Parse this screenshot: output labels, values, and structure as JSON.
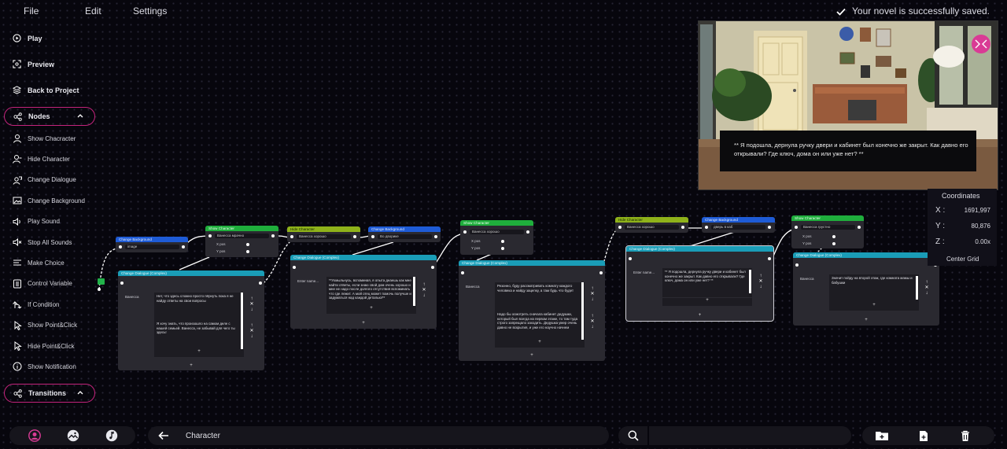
{
  "menu": {
    "file": "File",
    "edit": "Edit",
    "settings": "Settings"
  },
  "status": {
    "saved": "Your novel is successfully saved."
  },
  "sidebar": {
    "play": "Play",
    "preview": "Preview",
    "back": "Back to Project",
    "nodes_group": "Nodes",
    "node_items": [
      "Show Chacracter",
      "Hide Character",
      "Change Dialogue",
      "Change Background",
      "Play Sound",
      "Stop All Sounds",
      "Make Choice",
      "Control Variable",
      "If Condition",
      "Show Point&Click",
      "Hide Point&Click",
      "Show Notification"
    ],
    "transitions_group": "Transitions"
  },
  "preview": {
    "dialogue": "** Я подошла, дернула ручку двери и кабинет был конечно же закрыт. Как давно его открывали? Где ключ, дома он или уже нет? **"
  },
  "coordinates": {
    "title": "Coordinates",
    "x_label": "X :",
    "x": "1691,997",
    "y_label": "Y :",
    "y": "80,876",
    "z_label": "Z :",
    "z": "0.00x",
    "center": "Center Grid"
  },
  "nodes": {
    "n1_head": "Change Background",
    "n1_sel": "image",
    "n2_head": "Show Character",
    "n2_sel": "Ванесса мрачно",
    "n3_head": "Change Dialogue (Complex)",
    "n3_speaker": "Ванесса",
    "n3_text1": "Нет, что здесь сложно просто пёрнуть пока я не найду ответы на свои вопросы",
    "n3_text2": "Я хочу знать, что произошло на самом деле с нашей семьей. Ванесса, не забывай для чего ты здесь!",
    "n4_head": "Hide Character",
    "n4_sel": "Ванесса хорошо",
    "n5_head": "Change Background",
    "n5_sel": "Во дворике",
    "n6_head": "Change Dialogue (Complex)",
    "n6_speaker": "Enter name...",
    "n6_text": "**Ухмыльнусь, вспоминая, я опыта днаешь как мне найти ответы, если знаю свой дом очень хорошо и мне не надо после долгого отсутствия вспоминать что где лежит. А мой отец может помочь получше и задуматься над каждой деталью!**",
    "n7_head": "Show Character",
    "n7_sel": "Ванесса хорошо",
    "n8_head": "Change Dialogue (Complex)",
    "n8_speaker": "Ванесса",
    "n8_text1": "Резонно, буду рассматривать комнату каждого человека и найду зацепку, а там будь что будет",
    "n8_text2": "Надо бы осмотреть сначала кабинет дедушки, который был всегда на первом этаже, то там туда строго запрещало заходить. Дедушка умер очень давно не вскрытия, и уже его научно начнем",
    "n9_head": "Hide Character",
    "n9_sel": "Ванесса хорошо",
    "n10_head": "Change Background",
    "n10_sel": "дверь в каб",
    "n11_head": "Change Dialogue (Complex)",
    "n11_speaker": "Enter name...",
    "n11_text": "** Я подошла, дернула ручку двери и кабинет был конечно же закрыт. Как давно его открывали? Где ключ, дома он или уже нет? **",
    "n12_head": "Show Character",
    "n12_sel": "Ванесса грустно",
    "n13_head": "Change Dialogue (Complex)",
    "n13_speaker": "Ванесса",
    "n13_text": "Значит пойду на второй этаж, где комната мамы и бабушки",
    "x_pos": "X pos",
    "y_pos": "Y pos",
    "plus": "+"
  },
  "bottom": {
    "breadcrumb": "Character"
  },
  "colors": {
    "accent": "#c4247c",
    "blue": "#1e5bd6",
    "green": "#1fae3c",
    "olive": "#8fb21a",
    "teal": "#1a9db7"
  }
}
